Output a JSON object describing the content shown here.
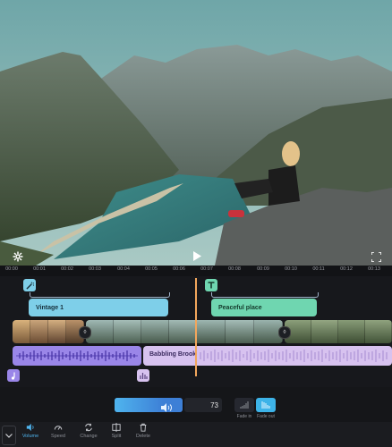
{
  "ruler": {
    "ticks": [
      "00:00",
      "00:01",
      "00:02",
      "00:03",
      "00:04",
      "00:05",
      "00:06",
      "00:07",
      "00:08",
      "00:09",
      "00:10",
      "00:11",
      "00:12",
      "00:13"
    ]
  },
  "tracks": {
    "text_clips": [
      "Vintage 1",
      "Peaceful place"
    ],
    "audio_clip_label": "Babbling Brook"
  },
  "volume": {
    "value": "73",
    "level": 0.73
  },
  "fade": {
    "fade_in_label": "Fade in",
    "fade_out_label": "Fade out",
    "active": "fade_out"
  },
  "toolbar": {
    "volume_label": "Volume",
    "speed_label": "Speed",
    "change_label": "Change",
    "split_label": "Split",
    "delete_label": "Delete"
  },
  "colors": {
    "accent": "#3db3e8",
    "text_track": "#7ecfe9",
    "text_track2": "#6fd6b0",
    "audio_track": "#9a86e8",
    "audio_track2": "#d7c2ef",
    "playhead": "#f2a65c"
  }
}
